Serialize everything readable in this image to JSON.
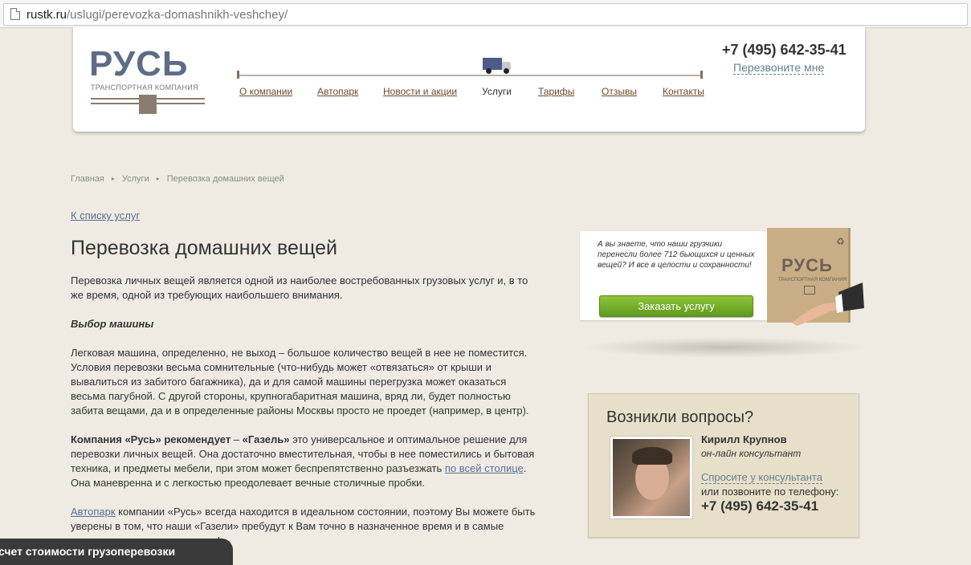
{
  "browser": {
    "url_domain": "rustk.ru",
    "url_path": "/uslugi/perevozka-domashnikh-veshchey/"
  },
  "header": {
    "logo_text": "РУСЬ",
    "logo_subtitle": "ТРАНСПОРТНАЯ КОМПАНИЯ",
    "nav": [
      {
        "label": "О компании",
        "active": false
      },
      {
        "label": "Автопарк",
        "active": false
      },
      {
        "label": "Новости и акции",
        "active": false
      },
      {
        "label": "Услуги",
        "active": true
      },
      {
        "label": "Тарифы",
        "active": false
      },
      {
        "label": "Отзывы",
        "active": false
      },
      {
        "label": "Контакты",
        "active": false
      }
    ],
    "phone": "+7 (495) 642-35-41",
    "callback": "Перезвоните мне"
  },
  "breadcrumb": [
    "Главная",
    "Услуги",
    "Перевозка домашних вещей"
  ],
  "back_link": "К списку услуг",
  "page_title": "Перевозка домашних вещей",
  "content": {
    "intro": "Перевозка личных вещей является одной из наиболее востребованных грузовых услуг и, в то же время, одной из требующих наибольшего внимания.",
    "section_title": "Выбор машины",
    "para1": "Легковая машина, определенно, не выход – большое количество вещей в нее не поместится. Условия перевозки весьма сомнительные (что-нибудь может «отвязаться» от крыши и вывалиться из забитого багажника), да и для самой машины перегрузка может оказаться весьма пагубной. С другой стороны, крупногабаритная машина, вряд ли, будет полностью забита вещами, да и в определенные районы Москвы просто не проедет (например, в центр).",
    "para2_bold": "Компания «Русь» рекомендует",
    "para2_dash": " – ",
    "para2_bold2": "«Газель»",
    "para2_text": " это универсальное и оптимальное решение для перевозки личных вещей. Она достаточно вместительная, чтобы в нее поместились и бытовая техника, и предметы мебели, при этом может беспрепятственно разъезжать ",
    "para2_link": "по всей столице",
    "para2_end": ". Она маневренна и с легкостью преодолевает вечные столичные пробки.",
    "para3_link": "Автопарк",
    "para3_text": " компании «Русь» всегда находится в идеальном состоянии, поэтому Вы можете быть уверены в том, что наши «Газели» пребудут к Вам точно в назначенное время и в самые отдаленные пункт назначения!"
  },
  "promo": {
    "text": "А вы знаете, что наши грузчики перенесли более 712 бьющихся и ценных вещей? И все в целости и сохранности!",
    "button": "Заказать услугу",
    "box_logo": "РУСЬ",
    "box_subtitle": "ТРАНСПОРТНАЯ КОМПАНИЯ"
  },
  "consultant": {
    "heading": "Возникли вопросы?",
    "name": "Кирилл Крупнов",
    "role": "он-лайн консультант",
    "ask_link": "Спросите у консультанта",
    "or_call": "или позвоните по телефону:",
    "phone": "+7 (495) 642-35-41"
  },
  "calc_tab": "счет стоимости грузоперевозки",
  "colors": {
    "page_bg": "#f0ebe2",
    "logo_blue": "#5d6d86",
    "nav_link": "#6b4a2e",
    "link_blue": "#586f9a",
    "button_green": "#7ab32e",
    "consult_bg": "#e6dfc9"
  }
}
